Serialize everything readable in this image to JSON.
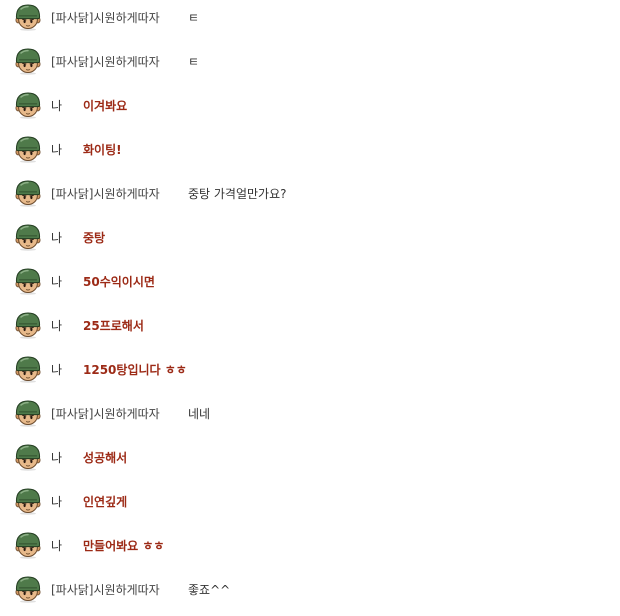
{
  "colors": {
    "my_message": "#9c2a16",
    "other_message": "#333333",
    "sender_name": "#444444",
    "helmet": "#4f7a4a",
    "face": "#e7b98a",
    "background": "#ffffff"
  },
  "avatar_icon": "soldier-helmet-avatar-icon",
  "messages": [
    {
      "sender": "[파사닭]시원하게따자",
      "text": "ㅌ",
      "mine": false
    },
    {
      "sender": "[파사닭]시원하게따자",
      "text": "ㅌ",
      "mine": false
    },
    {
      "sender": "나",
      "text": "이겨봐요",
      "mine": true
    },
    {
      "sender": "나",
      "text": "화이팅!",
      "mine": true
    },
    {
      "sender": "[파사닭]시원하게따자",
      "text": "중탕 가격얼만가요?",
      "mine": false
    },
    {
      "sender": "나",
      "text": "중탕",
      "mine": true
    },
    {
      "sender": "나",
      "text": "50수익이시면",
      "mine": true
    },
    {
      "sender": "나",
      "text": "25프로해서",
      "mine": true
    },
    {
      "sender": "나",
      "text": "1250탕입니다 ㅎㅎ",
      "mine": true
    },
    {
      "sender": "[파사닭]시원하게따자",
      "text": "네네",
      "mine": false
    },
    {
      "sender": "나",
      "text": "성공해서",
      "mine": true
    },
    {
      "sender": "나",
      "text": "인연깊게",
      "mine": true
    },
    {
      "sender": "나",
      "text": "만들어봐요 ㅎㅎ",
      "mine": true
    },
    {
      "sender": "[파사닭]시원하게따자",
      "text": "좋죠^^",
      "mine": false
    }
  ]
}
